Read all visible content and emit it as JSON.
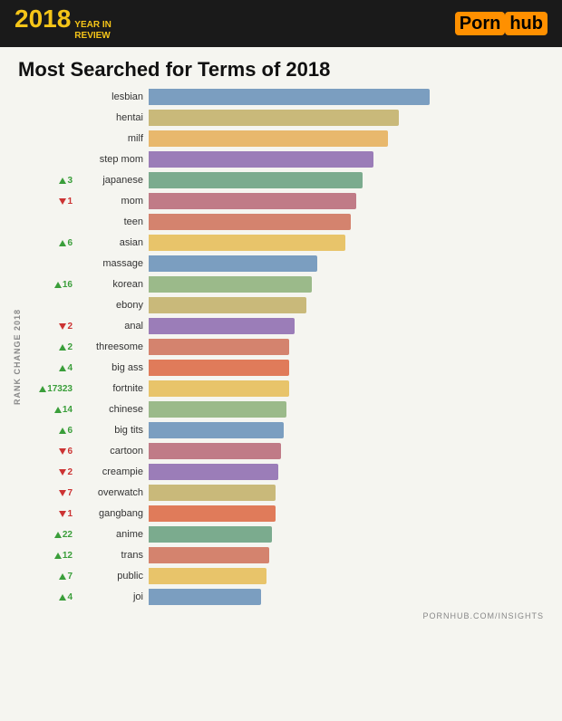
{
  "header": {
    "year": "2018",
    "review_line1": "YEAR IN",
    "review_line2": "REVIEW",
    "logo_text": "Porn",
    "logo_hub": "hub"
  },
  "main_title": "Most Searched for Terms of 2018",
  "rank_axis_label": "RANK CHANGE 2018",
  "footer": "PORNHUB.COM/INSIGHTS",
  "chart": {
    "max_bar_width": 310,
    "items": [
      {
        "term": "lesbian",
        "value": 100,
        "change_dir": "none",
        "change_val": "",
        "color_idx": 0
      },
      {
        "term": "hentai",
        "value": 89,
        "change_dir": "none",
        "change_val": "",
        "color_idx": 1
      },
      {
        "term": "milf",
        "value": 85,
        "change_dir": "none",
        "change_val": "",
        "color_idx": 2
      },
      {
        "term": "step mom",
        "value": 80,
        "change_dir": "none",
        "change_val": "",
        "color_idx": 3
      },
      {
        "term": "japanese",
        "value": 76,
        "change_dir": "up",
        "change_val": "3",
        "color_idx": 4
      },
      {
        "term": "mom",
        "value": 74,
        "change_dir": "down",
        "change_val": "1",
        "color_idx": 5
      },
      {
        "term": "teen",
        "value": 72,
        "change_dir": "none",
        "change_val": "",
        "color_idx": 6
      },
      {
        "term": "asian",
        "value": 70,
        "change_dir": "up",
        "change_val": "6",
        "color_idx": 7
      },
      {
        "term": "massage",
        "value": 60,
        "change_dir": "none",
        "change_val": "",
        "color_idx": 8
      },
      {
        "term": "korean",
        "value": 58,
        "change_dir": "up",
        "change_val": "16",
        "color_idx": 9
      },
      {
        "term": "ebony",
        "value": 56,
        "change_dir": "none",
        "change_val": "",
        "color_idx": 10
      },
      {
        "term": "anal",
        "value": 52,
        "change_dir": "down",
        "change_val": "2",
        "color_idx": 11
      },
      {
        "term": "threesome",
        "value": 50,
        "change_dir": "up",
        "change_val": "2",
        "color_idx": 12
      },
      {
        "term": "big ass",
        "value": 50,
        "change_dir": "up",
        "change_val": "4",
        "color_idx": 13
      },
      {
        "term": "fortnite",
        "value": 50,
        "change_dir": "up",
        "change_val": "17323",
        "color_idx": 14
      },
      {
        "term": "chinese",
        "value": 49,
        "change_dir": "up",
        "change_val": "14",
        "color_idx": 15
      },
      {
        "term": "big tits",
        "value": 48,
        "change_dir": "up",
        "change_val": "6",
        "color_idx": 16
      },
      {
        "term": "cartoon",
        "value": 47,
        "change_dir": "down",
        "change_val": "6",
        "color_idx": 17
      },
      {
        "term": "creampie",
        "value": 46,
        "change_dir": "down",
        "change_val": "2",
        "color_idx": 18
      },
      {
        "term": "overwatch",
        "value": 45,
        "change_dir": "down",
        "change_val": "7",
        "color_idx": 19
      },
      {
        "term": "gangbang",
        "value": 45,
        "change_dir": "down",
        "change_val": "1",
        "color_idx": 20
      },
      {
        "term": "anime",
        "value": 44,
        "change_dir": "up",
        "change_val": "22",
        "color_idx": 21
      },
      {
        "term": "trans",
        "value": 43,
        "change_dir": "up",
        "change_val": "12",
        "color_idx": 22
      },
      {
        "term": "public",
        "value": 42,
        "change_dir": "up",
        "change_val": "7",
        "color_idx": 23
      },
      {
        "term": "joi",
        "value": 40,
        "change_dir": "up",
        "change_val": "4",
        "color_idx": 24
      }
    ]
  }
}
